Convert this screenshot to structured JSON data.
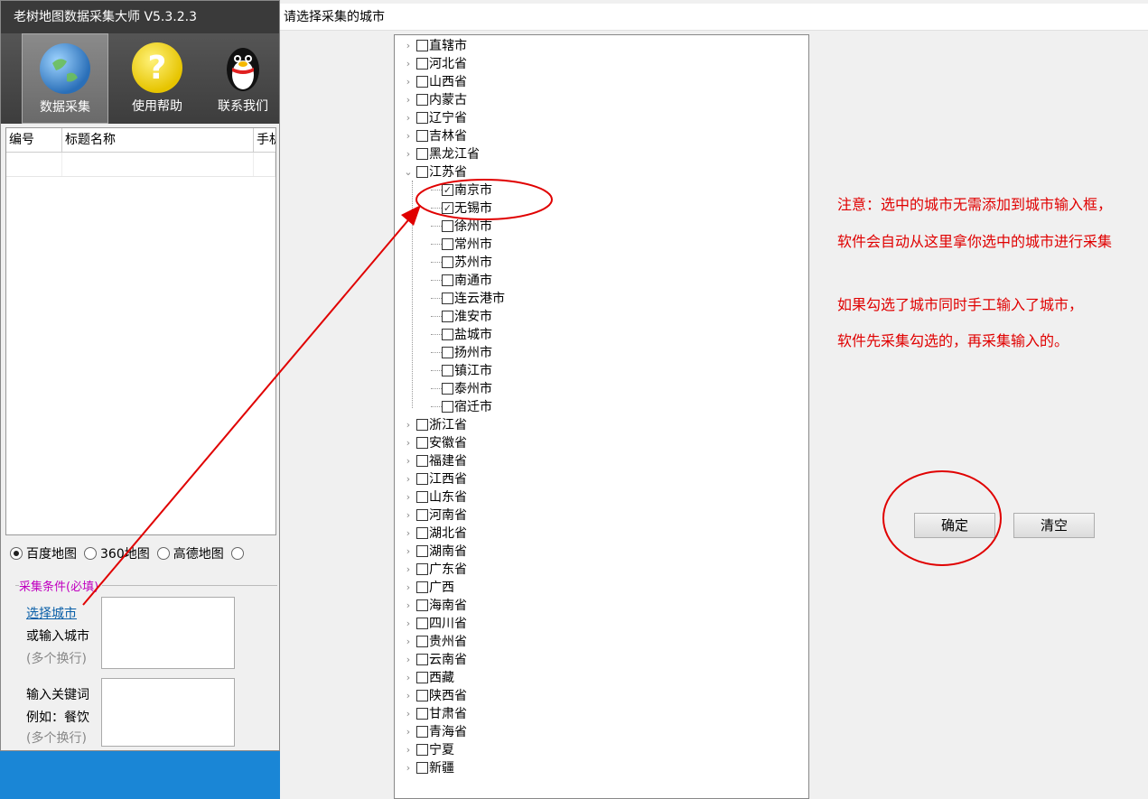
{
  "main_window": {
    "title": "老树地图数据采集大师 V5.3.2.3",
    "toolbar": [
      {
        "label": "数据采集",
        "icon": "globe-icon",
        "active": true
      },
      {
        "label": "使用帮助",
        "icon": "help-icon",
        "active": false
      },
      {
        "label": "联系我们",
        "icon": "qq-penguin-icon",
        "active": false
      }
    ],
    "grid_columns": [
      "编号",
      "标题名称",
      "手机"
    ],
    "map_sources": [
      "百度地图",
      "360地图",
      "高德地图"
    ],
    "selected_map_source": "百度地图",
    "conditions_legend": "采集条件(必填)",
    "select_city_link": "选择城市",
    "or_input_city": "或输入城市",
    "multi_line_hint": "(多个换行)",
    "keyword_label": "输入关键词",
    "keyword_example": "例如：餐饮",
    "keyword_hint": "(多个换行)"
  },
  "dialog": {
    "title": "请选择采集的城市",
    "provinces_before": [
      "直辖市",
      "河北省",
      "山西省",
      "内蒙古",
      "辽宁省",
      "吉林省",
      "黑龙江省"
    ],
    "expanded_province": "江苏省",
    "cities": [
      {
        "name": "南京市",
        "checked": true
      },
      {
        "name": "无锡市",
        "checked": true
      },
      {
        "name": "徐州市",
        "checked": false
      },
      {
        "name": "常州市",
        "checked": false
      },
      {
        "name": "苏州市",
        "checked": false
      },
      {
        "name": "南通市",
        "checked": false
      },
      {
        "name": "连云港市",
        "checked": false
      },
      {
        "name": "淮安市",
        "checked": false
      },
      {
        "name": "盐城市",
        "checked": false
      },
      {
        "name": "扬州市",
        "checked": false
      },
      {
        "name": "镇江市",
        "checked": false
      },
      {
        "name": "泰州市",
        "checked": false
      },
      {
        "name": "宿迁市",
        "checked": false
      }
    ],
    "provinces_after": [
      "浙江省",
      "安徽省",
      "福建省",
      "江西省",
      "山东省",
      "河南省",
      "湖北省",
      "湖南省",
      "广东省",
      "广西",
      "海南省",
      "四川省",
      "贵州省",
      "云南省",
      "西藏",
      "陕西省",
      "甘肃省",
      "青海省",
      "宁夏",
      "新疆"
    ],
    "notes": [
      "注意：选中的城市无需添加到城市输入框，",
      "软件会自动从这里拿你选中的城市进行采集",
      "如果勾选了城市同时手工输入了城市，",
      "软件先采集勾选的，再采集输入的。"
    ],
    "ok_label": "确定",
    "clear_label": "清空"
  },
  "colors": {
    "note_text": "#e00000",
    "annotation": "#e00000",
    "legend": "#c000c0"
  }
}
